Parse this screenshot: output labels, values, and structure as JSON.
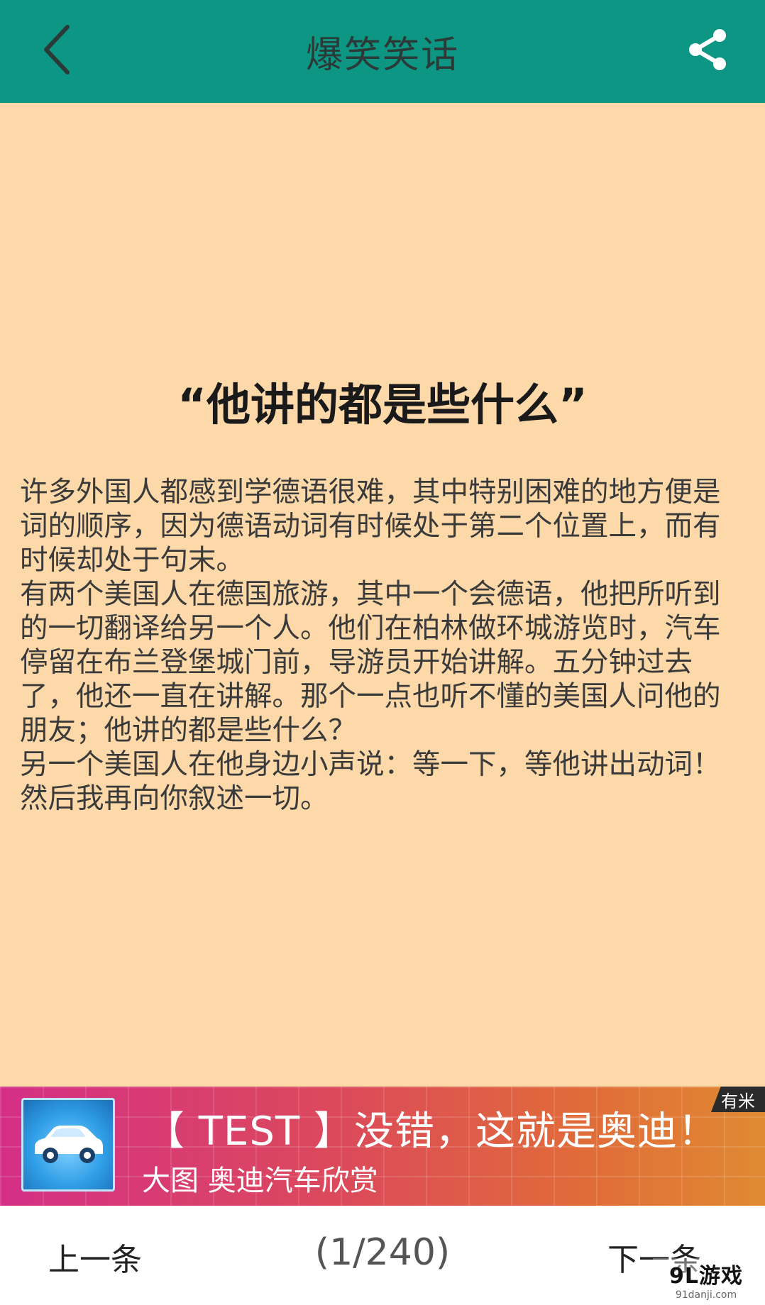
{
  "header": {
    "title": "爆笑笑话",
    "back_icon": "chevron-left-icon",
    "share_icon": "share-icon"
  },
  "joke": {
    "title": "“他讲的都是些什么”",
    "body": "许多外国人都感到学德语很难，其中特别困难的地方便是词的顺序，因为德语动词有时候处于第二个位置上，而有时候却处于句末。\n有两个美国人在德国旅游，其中一个会德语，他把所听到的一切翻译给另一个人。他们在柏林做环城游览时，汽车停留在布兰登堡城门前，导游员开始讲解。五分钟过去了，他还一直在讲解。那个一点也听不懂的美国人问他的朋友；他讲的都是些什么？\n另一个美国人在他身边小声说：等一下，等他讲出动词！然后我再向你叙述一切。"
  },
  "ad": {
    "headline": "【 TEST 】没错，这就是奥迪！",
    "subline": "大图 奥迪汽车欣赏",
    "badge": "有米",
    "thumb_icon": "car-icon"
  },
  "footer": {
    "prev_label": "上一条",
    "counter": "(1/240)",
    "next_label": "下一条"
  },
  "watermark": {
    "main": "9L游戏",
    "sub": "91danji.com"
  },
  "colors": {
    "header_bg": "#0d9683",
    "page_bg": "#fdd9aa",
    "footer_bg": "#ffffff"
  }
}
